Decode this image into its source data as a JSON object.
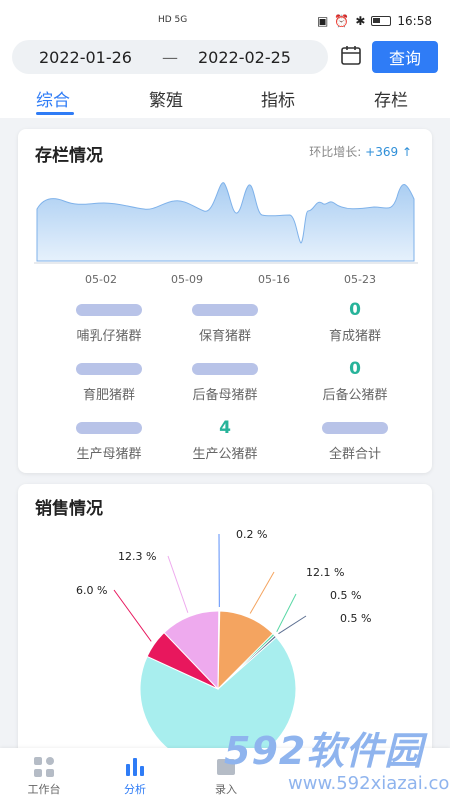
{
  "status_bar": {
    "time": "16:58",
    "network": "HD 5G"
  },
  "date_filter": {
    "start": "2022-01-26",
    "separator": "—",
    "end": "2022-02-25",
    "query_label": "查询"
  },
  "tabs": [
    "综合",
    "繁殖",
    "指标",
    "存栏"
  ],
  "active_tab": 0,
  "stock": {
    "title": "存栏情况",
    "growth_label": "环比增长:",
    "growth_value": "+369 ↑",
    "x_ticks": [
      "05-02",
      "05-09",
      "05-16",
      "05-23"
    ],
    "stats": [
      {
        "value": "",
        "label": "哺乳仔猪群",
        "redacted": true
      },
      {
        "value": "",
        "label": "保育猪群",
        "redacted": true
      },
      {
        "value": "0",
        "label": "育成猪群",
        "redacted": false
      },
      {
        "value": "",
        "label": "育肥猪群",
        "redacted": true
      },
      {
        "value": "",
        "label": "后备母猪群",
        "redacted": true
      },
      {
        "value": "0",
        "label": "后备公猪群",
        "redacted": false
      },
      {
        "value": "",
        "label": "生产母猪群",
        "redacted": true
      },
      {
        "value": "4",
        "label": "生产公猪群",
        "redacted": false
      },
      {
        "value": "",
        "label": "全群合计",
        "redacted": true
      }
    ]
  },
  "sales": {
    "title": "销售情况",
    "slices": [
      {
        "label": "0.2 %",
        "percent": 0.2,
        "color": "#5b8ff9"
      },
      {
        "label": "12.1 %",
        "percent": 12.1,
        "color": "#f4a460"
      },
      {
        "label": "0.5 %",
        "percent": 0.5,
        "color": "#5ad8a6"
      },
      {
        "label": "0.5 %",
        "percent": 0.5,
        "color": "#5d7092"
      },
      {
        "label": "68.4 %",
        "percent": 68.4,
        "color": "#a8eeee"
      },
      {
        "label": "6.0 %",
        "percent": 6.0,
        "color": "#e8175d"
      },
      {
        "label": "12.3 %",
        "percent": 12.3,
        "color": "#eeaaee"
      }
    ]
  },
  "nav": [
    {
      "label": "工作台",
      "icon": "grid-icon"
    },
    {
      "label": "分析",
      "icon": "bar-chart-icon"
    },
    {
      "label": "录入",
      "icon": "input-icon"
    }
  ],
  "active_nav": 1,
  "watermark": {
    "logo": "592软件园",
    "url": "www.592xiazai.com"
  },
  "colors": {
    "accent": "#2f7cf6",
    "stat_green": "#27b39a",
    "area_fill": "#c4dcf4"
  }
}
